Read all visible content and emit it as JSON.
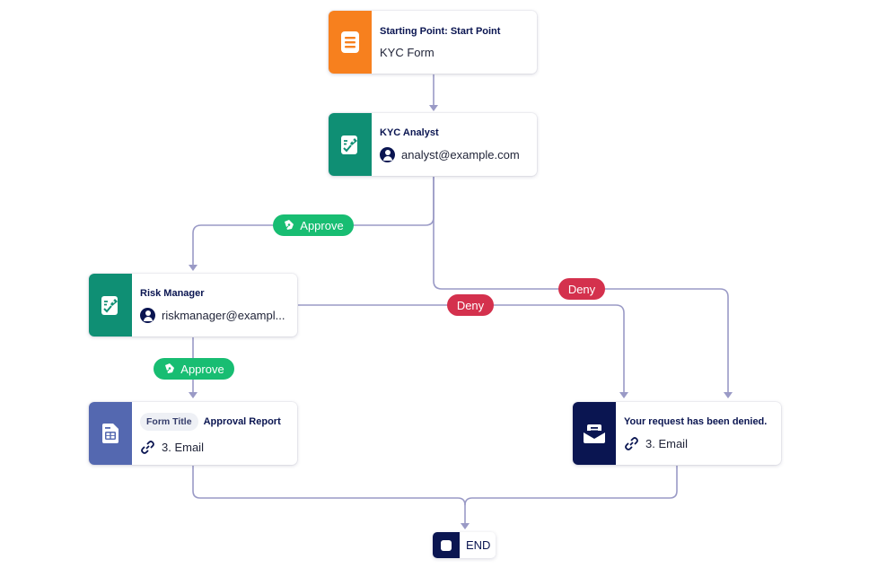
{
  "colors": {
    "start": "#f7801e",
    "approver": "#0f8f74",
    "form": "#5468b0",
    "email": "#0a1551",
    "end": "#0a1551",
    "approve": "#18bd72",
    "deny": "#d4314d",
    "edge": "#9a9ac6"
  },
  "nodes": {
    "start": {
      "title": "Starting Point: Start Point",
      "subtitle": "KYC Form",
      "icon": "form-document-icon"
    },
    "kyc_analyst": {
      "title": "KYC Analyst",
      "assignee": "analyst@example.com",
      "icon": "approval-sign-icon"
    },
    "risk_manager": {
      "title": "Risk Manager",
      "assignee": "riskmanager@exampl...",
      "icon": "approval-sign-icon"
    },
    "approval_report": {
      "chip": "Form Title",
      "title": "Approval Report",
      "link": "3. Email",
      "icon": "form-table-icon"
    },
    "denied_email": {
      "title": "Your request has been denied.",
      "link": "3. Email",
      "icon": "envelope-icon"
    },
    "end": {
      "label": "END",
      "icon": "stop-square-icon"
    }
  },
  "edges": {
    "approve_1": "Approve",
    "approve_2": "Approve",
    "deny_1": "Deny",
    "deny_2": "Deny"
  }
}
